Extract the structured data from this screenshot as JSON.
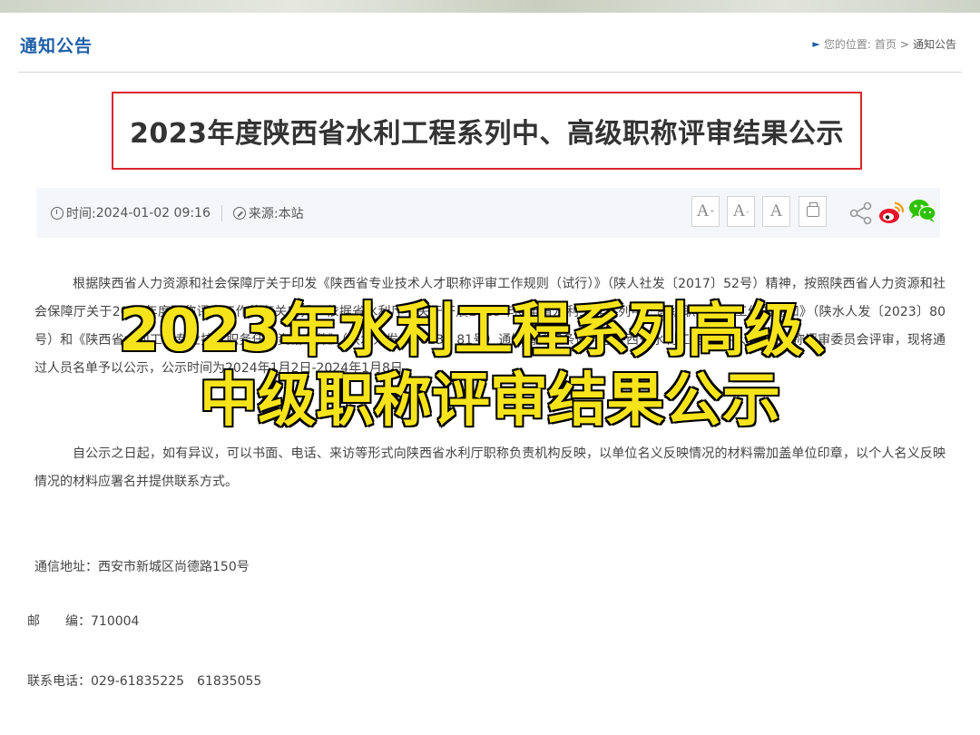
{
  "header": {
    "section_title": "通知公告",
    "breadcrumb": {
      "prefix": "您的位置:",
      "home": "首页",
      "separator": ">",
      "current": "通知公告"
    }
  },
  "article": {
    "title": "2023年度陕西省水利工程系列中、高级职称评审结果公示",
    "meta": {
      "time_label": "时间:",
      "time_value": "2024-01-02 09:16",
      "source_label": "来源:",
      "source_value": "本站"
    },
    "toolbar": {
      "font_large": "A",
      "font_medium": "A",
      "font_small": "A"
    },
    "paragraph_1": "根据陕西省人力资源和社会保障厅关于印发《陕西省专业技术人才职称评审工作规则（试行）》（陕人社发〔2017〕52号）精神，按照陕西省人力资源和社会保障厅关于2023年度职称评审工作的有关安排，依据省水利厅《关于开展2023年度全省水利工程系列中、高级职称评审工作的通知》（陕水人发〔2023〕80号）和《陕西省水利工程专业技术职务任职资格条件》（陕水人发〔2023〕81号）通知精神和条件，经陕西省水利工程技术中、高级职称评审委员会评审，现将通过人员名单予以公示，公示时间为2024年1月2日-2024年1月8日。",
    "paragraph_2": "自公示之日起，如有异议，可以书面、电话、来访等形式向陕西省水利厅职称负责机构反映，以单位名义反映情况的材料需加盖单位印章，以个人名义反映情况的材料应署名并提供联系方式。",
    "address": "通信地址：西安市新城区尚德路150号",
    "postcode": "邮　　编：710004",
    "phone": "联系电话：029-61835225　61835055"
  },
  "overlay": {
    "line1": "2023年水利工程系列高级、",
    "line2": "中级职称评审结果公示",
    "text_color": "#f7e31a"
  },
  "colors": {
    "accent_blue": "#1f5fa8",
    "title_border_red": "#d9262c",
    "weibo_red": "#e6162d",
    "wechat_green": "#2dc100"
  }
}
